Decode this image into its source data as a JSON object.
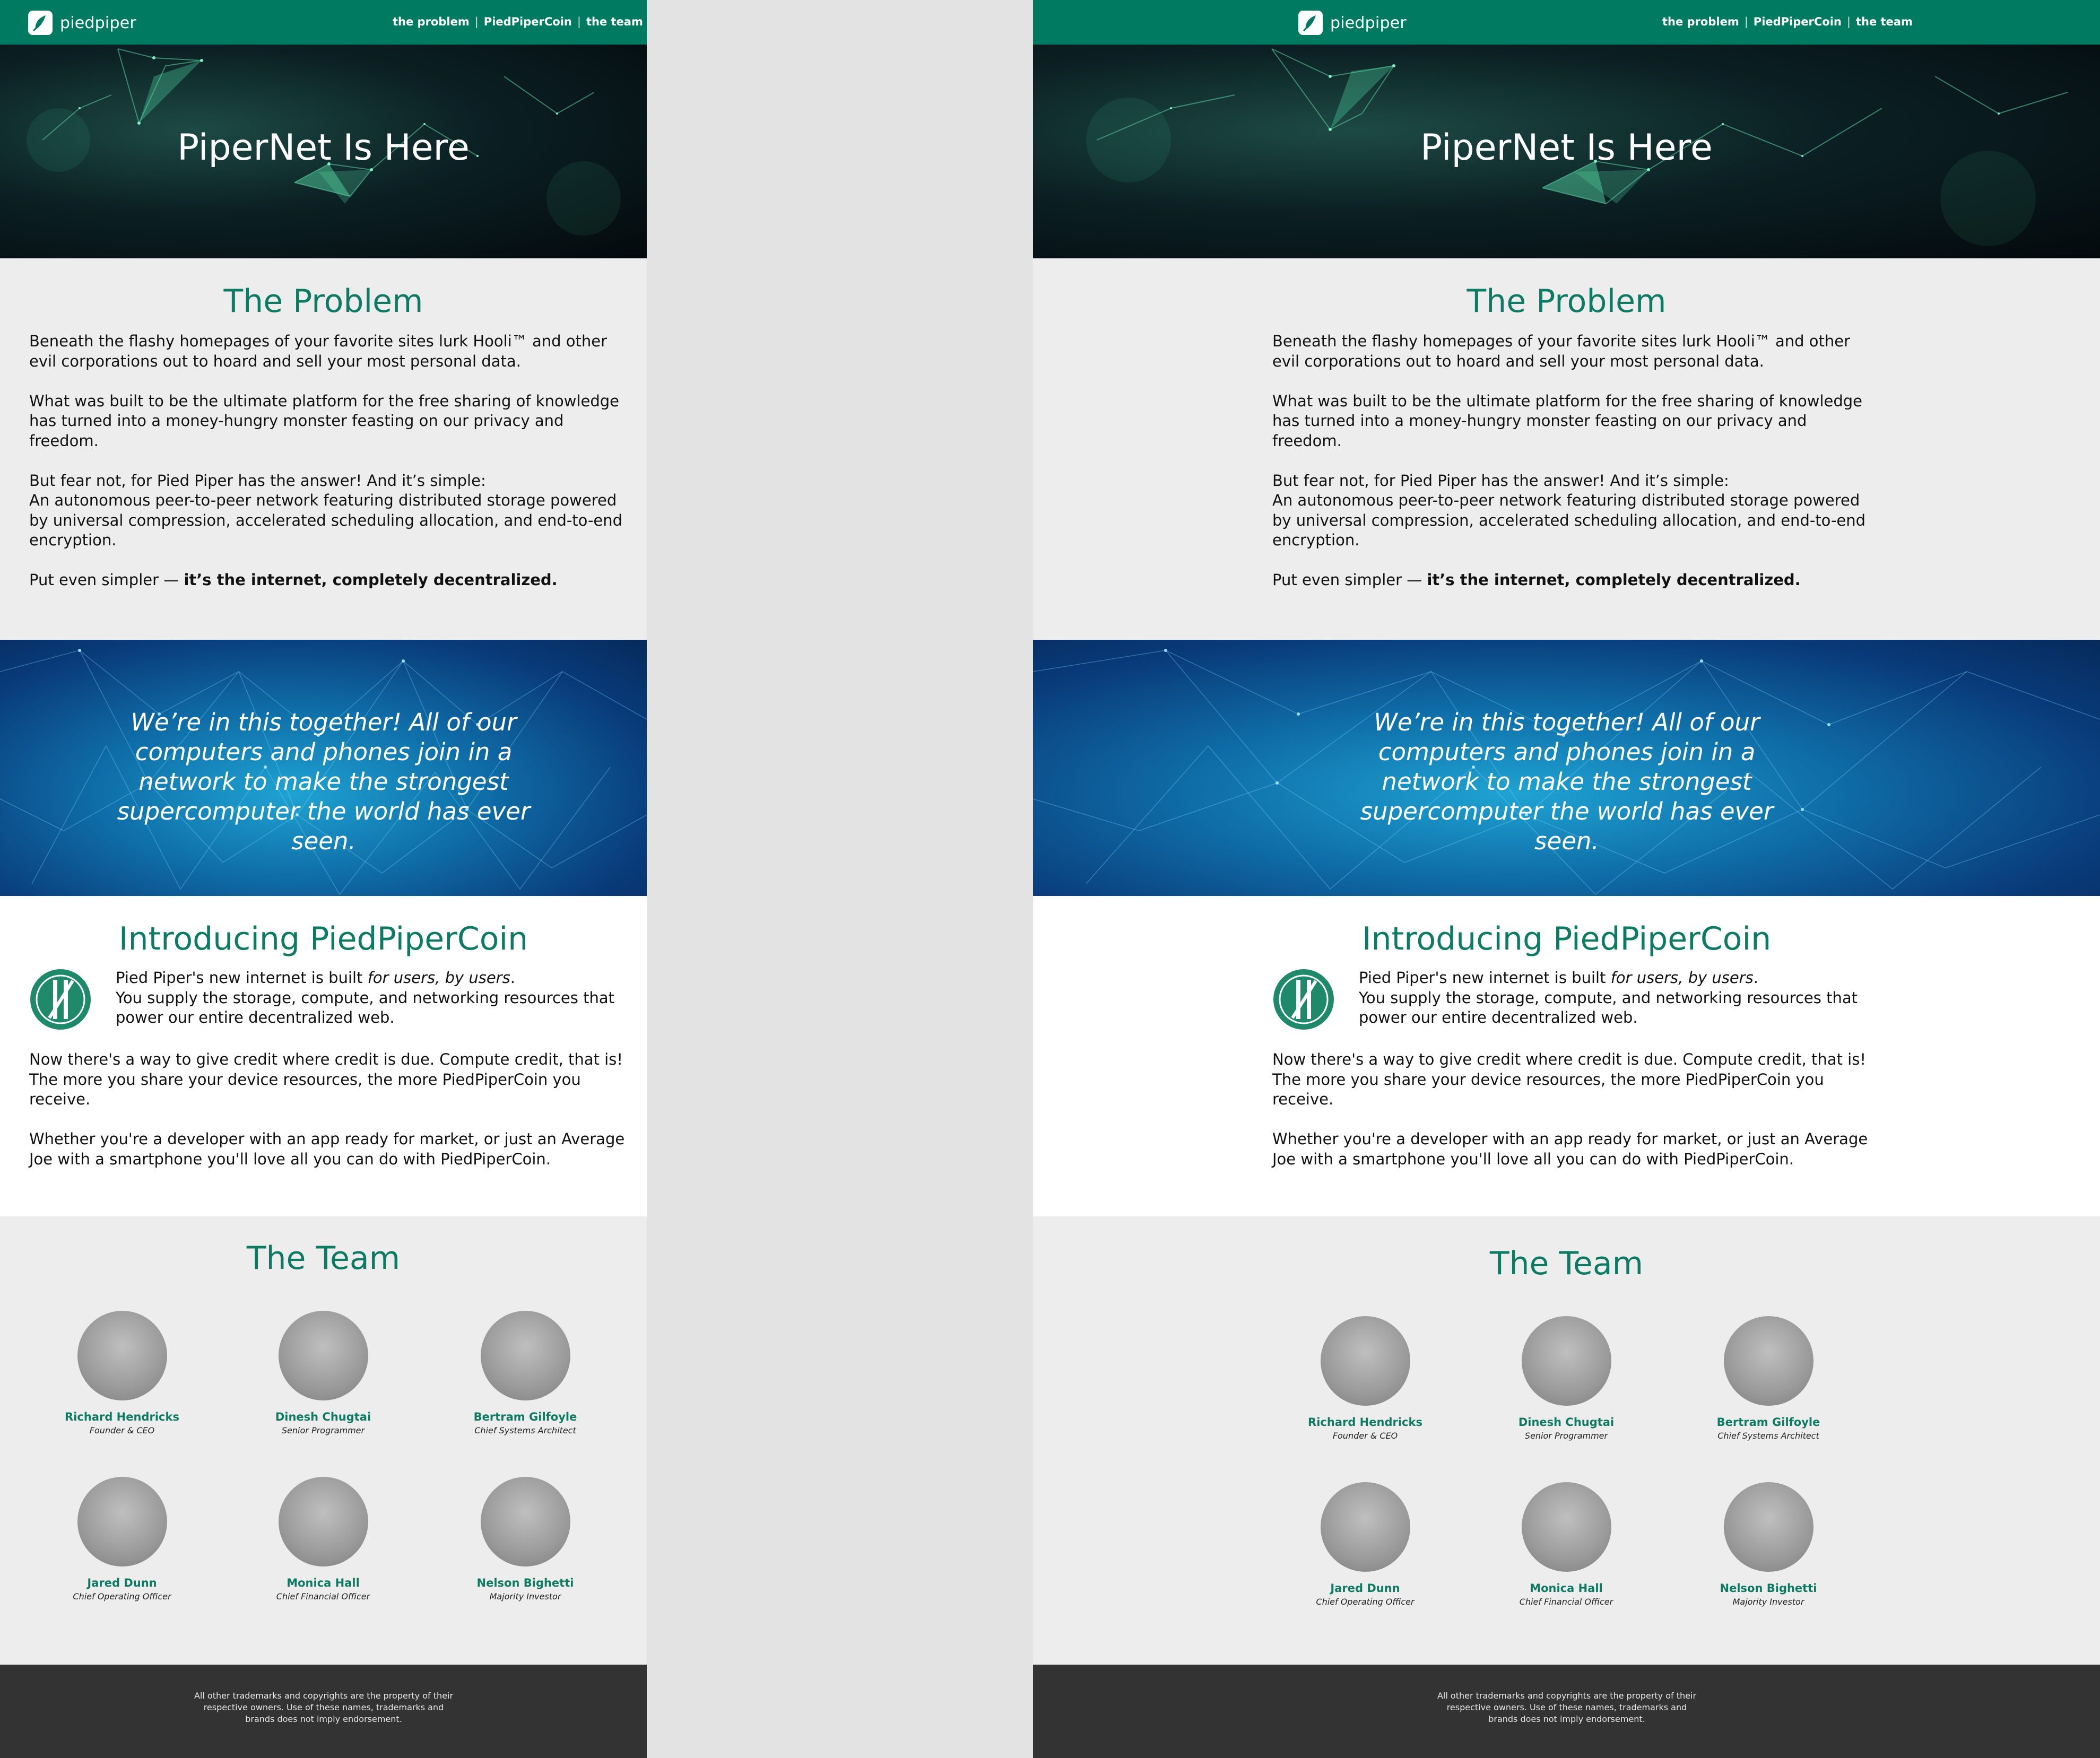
{
  "brand": {
    "name": "piedpiper"
  },
  "nav": {
    "links": [
      "the problem",
      "PiedPiperCoin",
      "the team"
    ],
    "separator": "|"
  },
  "hero": {
    "title": "PiperNet Is Here"
  },
  "problem": {
    "heading": "The Problem",
    "p1": "Beneath the flashy homepages of your favorite sites lurk Hooli™ and other evil corporations out to hoard and sell your most personal data.",
    "p2": "What was built to be the ultimate platform for the free sharing of knowledge has turned into a money-hungry monster feasting on our privacy and freedom.",
    "p3_line1": "But fear not, for Pied Piper has the answer! And it’s simple:",
    "p3_line2": "An autonomous peer-to-peer network featuring distributed storage powered by universal compression, accelerated scheduling allocation, and end-to-end encryption.",
    "p4_prefix": "Put even simpler — ",
    "p4_bold": "it’s the internet, completely decentralized."
  },
  "quote": {
    "text": "We’re in this together! All of our computers and phones join in a network to make the strongest supercomputer the world has ever seen."
  },
  "intro": {
    "heading": "Introducing PiedPiperCoin",
    "side_prefix": "Pied Piper's new internet is built ",
    "side_italic": "for users, by users",
    "side_suffix": ".",
    "side_line2": "You supply the storage, compute, and networking resources that power our entire decentralized web.",
    "p2": "Now there's a way to give credit where credit is due. Compute credit, that is! The more you share your device resources, the more PiedPiperCoin you receive.",
    "p3": "Whether you're a developer with an app ready for market, or just an Average Joe with a smartphone you'll love all you can do with PiedPiperCoin."
  },
  "team": {
    "heading": "The Team",
    "members": [
      {
        "name": "Richard Hendricks",
        "role": "Founder & CEO"
      },
      {
        "name": "Dinesh Chugtai",
        "role": "Senior Programmer"
      },
      {
        "name": "Bertram Gilfoyle",
        "role": "Chief Systems Architect"
      },
      {
        "name": "Jared Dunn",
        "role": "Chief Operating Officer"
      },
      {
        "name": "Monica Hall",
        "role": "Chief Financial Officer"
      },
      {
        "name": "Nelson Bighetti",
        "role": "Majority Investor"
      }
    ]
  },
  "footer": {
    "text": "All other trademarks and copyrights are the property of their respective owners. Use of these names, trademarks and brands does not imply endorsement."
  },
  "colors": {
    "brand": "#007a60",
    "heading": "#0d7b63",
    "footer_bg": "#333333",
    "section_bg": "#ededed"
  }
}
